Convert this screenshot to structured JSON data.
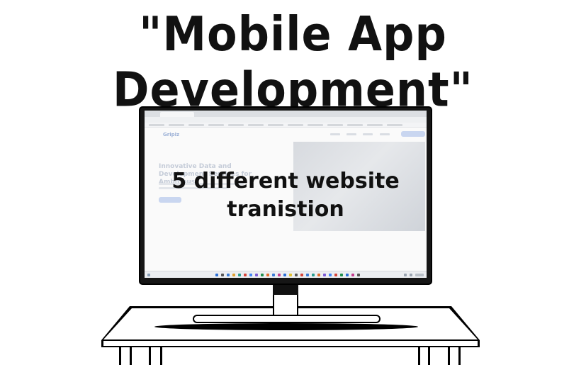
{
  "heading": "\"Mobile App Development\"",
  "screen": {
    "overlay_line1": "5 different website",
    "overlay_line2": "tranistion",
    "site_logo": "Gripiz",
    "hero_heading": "Innovative Data and Development Services for Ambitious"
  }
}
